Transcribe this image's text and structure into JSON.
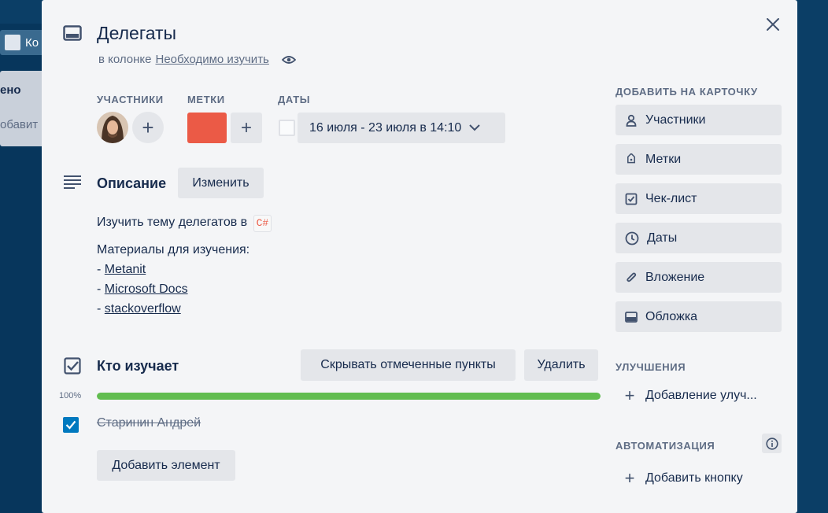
{
  "background": {
    "board_button_text": "Ко",
    "list_text_1": "ено",
    "list_text_2": "обавит"
  },
  "card": {
    "title": "Делегаты",
    "in_list_prefix": "в колонке",
    "list_name": "Необходимо изучить"
  },
  "members": {
    "label": "УЧАСТНИКИ",
    "add": "+"
  },
  "labels": {
    "label": "МЕТКИ",
    "add": "+",
    "color": "#eb5a46"
  },
  "dates": {
    "label": "ДАТЫ",
    "value": "16 июля - 23 июля в 14:10"
  },
  "description": {
    "heading": "Описание",
    "edit_button": "Изменить",
    "line1": "Изучить тему делегатов в",
    "code": "C#",
    "line2": "Материалы для изучения:",
    "dash": "- ",
    "links": [
      "Metanit",
      "Microsoft Docs",
      "stackoverflow"
    ]
  },
  "checklist": {
    "heading": "Кто изучает",
    "hide_button": "Скрывать отмеченные пункты",
    "delete_button": "Удалить",
    "progress_text": "100%",
    "progress": 1.0,
    "items": [
      {
        "text": "Старинин Андрей",
        "checked": true
      }
    ],
    "add_item_button": "Добавить элемент"
  },
  "sidebar": {
    "add_to_card_label": "ДОБАВИТЬ НА КАРТОЧКУ",
    "buttons": [
      "Участники",
      "Метки",
      "Чек-лист",
      "Даты",
      "Вложение",
      "Обложка"
    ],
    "powerups_label": "УЛУЧШЕНИЯ",
    "add_powerup": "Добавление улуч...",
    "automation_label": "АВТОМАТИЗАЦИЯ",
    "add_button": "Добавить кнопку"
  },
  "colors": {
    "accent": "#0079bf",
    "progress": "#61bd4f",
    "label_red": "#eb5a46"
  }
}
